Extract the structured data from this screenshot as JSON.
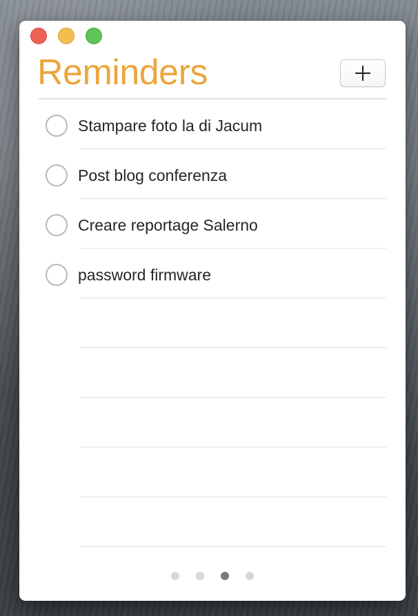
{
  "app": {
    "title": "Reminders",
    "accent_color": "#eba63c"
  },
  "window_controls": {
    "close_icon": "close-icon",
    "minimize_icon": "minimize-icon",
    "zoom_icon": "zoom-icon"
  },
  "toolbar": {
    "add_icon": "plus-icon"
  },
  "reminders": [
    {
      "text": "Stampare foto la di Jacum",
      "completed": false
    },
    {
      "text": "Post blog conferenza",
      "completed": false
    },
    {
      "text": "Creare reportage Salerno",
      "completed": false
    },
    {
      "text": "password firmware",
      "completed": false
    },
    {
      "text": "",
      "completed": false
    },
    {
      "text": "",
      "completed": false
    },
    {
      "text": "",
      "completed": false
    },
    {
      "text": "",
      "completed": false
    },
    {
      "text": "",
      "completed": false
    }
  ],
  "pagination": {
    "total_pages": 4,
    "current_page": 3
  }
}
